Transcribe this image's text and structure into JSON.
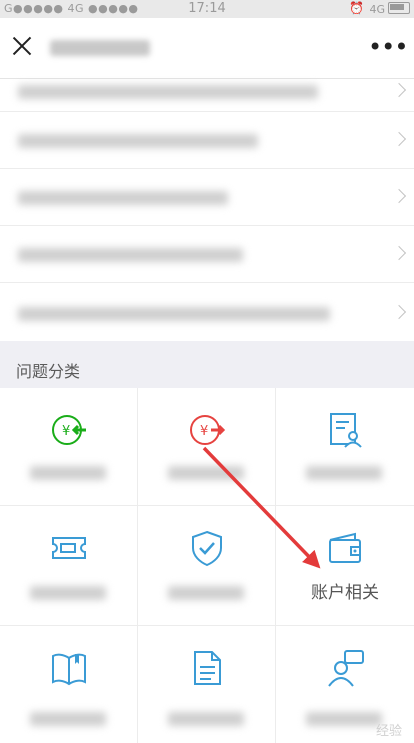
{
  "status_bar": {
    "carrier_left": "G●●●●● 4G ●●●●●",
    "time": "17:14",
    "network_right": "4G"
  },
  "section": {
    "title": "问题分类"
  },
  "categories": [
    {
      "icon": "yuan-in-icon",
      "label": ""
    },
    {
      "icon": "yuan-out-icon",
      "label": ""
    },
    {
      "icon": "profile-document-icon",
      "label": ""
    },
    {
      "icon": "ticket-icon",
      "label": ""
    },
    {
      "icon": "shield-check-icon",
      "label": ""
    },
    {
      "icon": "wallet-icon",
      "label": "账户相关"
    },
    {
      "icon": "book-icon",
      "label": ""
    },
    {
      "icon": "document-icon",
      "label": ""
    },
    {
      "icon": "customer-service-icon",
      "label": ""
    }
  ],
  "colors": {
    "green": "#1aad19",
    "red": "#e64340",
    "blue": "#3a9bd5",
    "arrow": "#e33b3b"
  },
  "watermark": "经验"
}
